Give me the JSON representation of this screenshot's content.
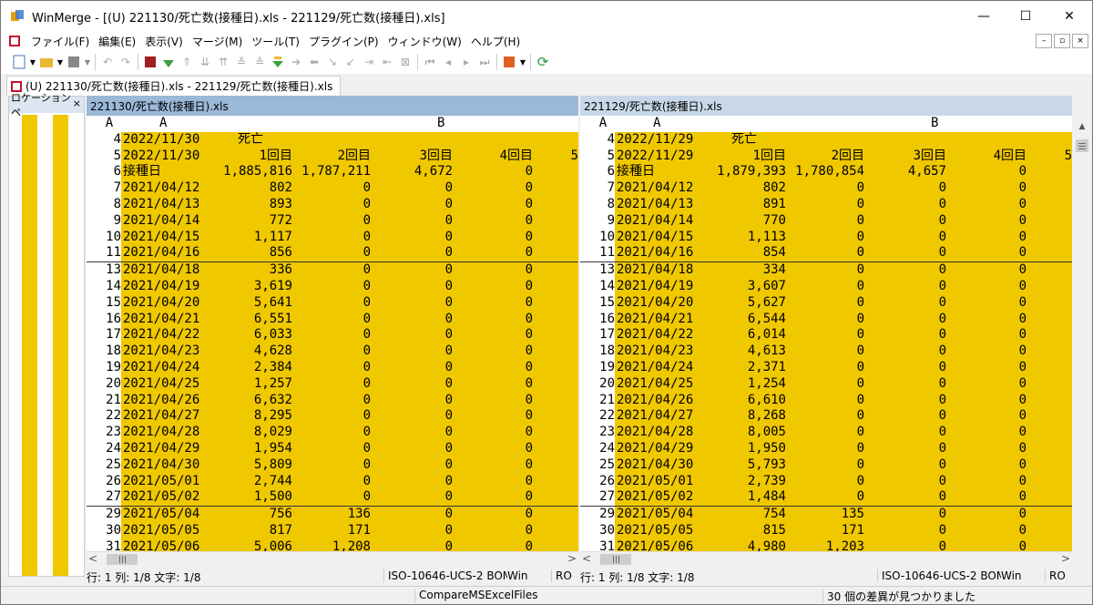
{
  "title": "WinMerge - [(U) 221130/死亡数(接種日).xls - 221129/死亡数(接種日).xls]",
  "window_buttons": {
    "minimize": "—",
    "maximize": "☐",
    "close": "✕"
  },
  "menu": [
    "ファイル(F)",
    "編集(E)",
    "表示(V)",
    "マージ(M)",
    "ツール(T)",
    "プラグイン(P)",
    "ウィンドウ(W)",
    "ヘルプ(H)"
  ],
  "mdi_buttons": {
    "minimize": "–",
    "restore": "▫",
    "close": "×"
  },
  "tab_label": "(U) 221130/死亡数(接種日).xls - 221129/死亡数(接種日).xls",
  "location_pane": {
    "title": "ロケーション ペ",
    "close": "×"
  },
  "colors": {
    "diff": "#f0c800",
    "left_header": "#9ab8d8",
    "right_header": "#c8d8e8"
  },
  "left": {
    "header": "221130/死亡数(接種日).xls",
    "col_header": {
      "rownum": "A",
      "a": "A",
      "b": "B"
    },
    "rows": [
      {
        "n": "4",
        "a": "2022/11/30",
        "c1": "死亡",
        "c2": "",
        "c3": "",
        "c4": "",
        "c5": ""
      },
      {
        "n": "5",
        "a": "2022/11/30",
        "c1": "1回目",
        "c2": "2回目",
        "c3": "3回目",
        "c4": "4回目",
        "c5": "5"
      },
      {
        "n": "6",
        "a": "接種日",
        "c1": "1,885,816",
        "c2": "1,787,211",
        "c3": "4,672",
        "c4": "0",
        "c5": ""
      },
      {
        "n": "7",
        "a": "2021/04/12",
        "c1": "802",
        "c2": "0",
        "c3": "0",
        "c4": "0",
        "c5": ""
      },
      {
        "n": "8",
        "a": "2021/04/13",
        "c1": "893",
        "c2": "0",
        "c3": "0",
        "c4": "0",
        "c5": ""
      },
      {
        "n": "9",
        "a": "2021/04/14",
        "c1": "772",
        "c2": "0",
        "c3": "0",
        "c4": "0",
        "c5": ""
      },
      {
        "n": "10",
        "a": "2021/04/15",
        "c1": "1,117",
        "c2": "0",
        "c3": "0",
        "c4": "0",
        "c5": ""
      },
      {
        "n": "11",
        "a": "2021/04/16",
        "c1": "856",
        "c2": "0",
        "c3": "0",
        "c4": "0",
        "c5": ""
      },
      {
        "n": "13",
        "a": "2021/04/18",
        "c1": "336",
        "c2": "0",
        "c3": "0",
        "c4": "0",
        "c5": ""
      },
      {
        "n": "14",
        "a": "2021/04/19",
        "c1": "3,619",
        "c2": "0",
        "c3": "0",
        "c4": "0",
        "c5": ""
      },
      {
        "n": "15",
        "a": "2021/04/20",
        "c1": "5,641",
        "c2": "0",
        "c3": "0",
        "c4": "0",
        "c5": ""
      },
      {
        "n": "16",
        "a": "2021/04/21",
        "c1": "6,551",
        "c2": "0",
        "c3": "0",
        "c4": "0",
        "c5": ""
      },
      {
        "n": "17",
        "a": "2021/04/22",
        "c1": "6,033",
        "c2": "0",
        "c3": "0",
        "c4": "0",
        "c5": ""
      },
      {
        "n": "18",
        "a": "2021/04/23",
        "c1": "4,628",
        "c2": "0",
        "c3": "0",
        "c4": "0",
        "c5": ""
      },
      {
        "n": "19",
        "a": "2021/04/24",
        "c1": "2,384",
        "c2": "0",
        "c3": "0",
        "c4": "0",
        "c5": ""
      },
      {
        "n": "20",
        "a": "2021/04/25",
        "c1": "1,257",
        "c2": "0",
        "c3": "0",
        "c4": "0",
        "c5": ""
      },
      {
        "n": "21",
        "a": "2021/04/26",
        "c1": "6,632",
        "c2": "0",
        "c3": "0",
        "c4": "0",
        "c5": ""
      },
      {
        "n": "22",
        "a": "2021/04/27",
        "c1": "8,295",
        "c2": "0",
        "c3": "0",
        "c4": "0",
        "c5": ""
      },
      {
        "n": "23",
        "a": "2021/04/28",
        "c1": "8,029",
        "c2": "0",
        "c3": "0",
        "c4": "0",
        "c5": ""
      },
      {
        "n": "24",
        "a": "2021/04/29",
        "c1": "1,954",
        "c2": "0",
        "c3": "0",
        "c4": "0",
        "c5": ""
      },
      {
        "n": "25",
        "a": "2021/04/30",
        "c1": "5,809",
        "c2": "0",
        "c3": "0",
        "c4": "0",
        "c5": ""
      },
      {
        "n": "26",
        "a": "2021/05/01",
        "c1": "2,744",
        "c2": "0",
        "c3": "0",
        "c4": "0",
        "c5": ""
      },
      {
        "n": "27",
        "a": "2021/05/02",
        "c1": "1,500",
        "c2": "0",
        "c3": "0",
        "c4": "0",
        "c5": ""
      },
      {
        "n": "29",
        "a": "2021/05/04",
        "c1": "756",
        "c2": "136",
        "c3": "0",
        "c4": "0",
        "c5": ""
      },
      {
        "n": "30",
        "a": "2021/05/05",
        "c1": "817",
        "c2": "171",
        "c3": "0",
        "c4": "0",
        "c5": ""
      },
      {
        "n": "31",
        "a": "2021/05/06",
        "c1": "5,006",
        "c2": "1,208",
        "c3": "0",
        "c4": "0",
        "c5": ""
      }
    ],
    "status": {
      "pos": "行: 1  列: 1/8  文字: 1/8",
      "enc": "ISO-10646-UCS-2 BOM",
      "eol": "Win",
      "ro": "RO"
    }
  },
  "right": {
    "header": "221129/死亡数(接種日).xls",
    "col_header": {
      "rownum": "A",
      "a": "A",
      "b": "B"
    },
    "rows": [
      {
        "n": "4",
        "a": "2022/11/29",
        "c1": "死亡",
        "c2": "",
        "c3": "",
        "c4": "",
        "c5": ""
      },
      {
        "n": "5",
        "a": "2022/11/29",
        "c1": "1回目",
        "c2": "2回目",
        "c3": "3回目",
        "c4": "4回目",
        "c5": "5"
      },
      {
        "n": "6",
        "a": "接種日",
        "c1": "1,879,393",
        "c2": "1,780,854",
        "c3": "4,657",
        "c4": "0",
        "c5": ""
      },
      {
        "n": "7",
        "a": "2021/04/12",
        "c1": "802",
        "c2": "0",
        "c3": "0",
        "c4": "0",
        "c5": ""
      },
      {
        "n": "8",
        "a": "2021/04/13",
        "c1": "891",
        "c2": "0",
        "c3": "0",
        "c4": "0",
        "c5": ""
      },
      {
        "n": "9",
        "a": "2021/04/14",
        "c1": "770",
        "c2": "0",
        "c3": "0",
        "c4": "0",
        "c5": ""
      },
      {
        "n": "10",
        "a": "2021/04/15",
        "c1": "1,113",
        "c2": "0",
        "c3": "0",
        "c4": "0",
        "c5": ""
      },
      {
        "n": "11",
        "a": "2021/04/16",
        "c1": "854",
        "c2": "0",
        "c3": "0",
        "c4": "0",
        "c5": ""
      },
      {
        "n": "13",
        "a": "2021/04/18",
        "c1": "334",
        "c2": "0",
        "c3": "0",
        "c4": "0",
        "c5": ""
      },
      {
        "n": "14",
        "a": "2021/04/19",
        "c1": "3,607",
        "c2": "0",
        "c3": "0",
        "c4": "0",
        "c5": ""
      },
      {
        "n": "15",
        "a": "2021/04/20",
        "c1": "5,627",
        "c2": "0",
        "c3": "0",
        "c4": "0",
        "c5": ""
      },
      {
        "n": "16",
        "a": "2021/04/21",
        "c1": "6,544",
        "c2": "0",
        "c3": "0",
        "c4": "0",
        "c5": ""
      },
      {
        "n": "17",
        "a": "2021/04/22",
        "c1": "6,014",
        "c2": "0",
        "c3": "0",
        "c4": "0",
        "c5": ""
      },
      {
        "n": "18",
        "a": "2021/04/23",
        "c1": "4,613",
        "c2": "0",
        "c3": "0",
        "c4": "0",
        "c5": ""
      },
      {
        "n": "19",
        "a": "2021/04/24",
        "c1": "2,371",
        "c2": "0",
        "c3": "0",
        "c4": "0",
        "c5": ""
      },
      {
        "n": "20",
        "a": "2021/04/25",
        "c1": "1,254",
        "c2": "0",
        "c3": "0",
        "c4": "0",
        "c5": ""
      },
      {
        "n": "21",
        "a": "2021/04/26",
        "c1": "6,610",
        "c2": "0",
        "c3": "0",
        "c4": "0",
        "c5": ""
      },
      {
        "n": "22",
        "a": "2021/04/27",
        "c1": "8,268",
        "c2": "0",
        "c3": "0",
        "c4": "0",
        "c5": ""
      },
      {
        "n": "23",
        "a": "2021/04/28",
        "c1": "8,005",
        "c2": "0",
        "c3": "0",
        "c4": "0",
        "c5": ""
      },
      {
        "n": "24",
        "a": "2021/04/29",
        "c1": "1,950",
        "c2": "0",
        "c3": "0",
        "c4": "0",
        "c5": ""
      },
      {
        "n": "25",
        "a": "2021/04/30",
        "c1": "5,793",
        "c2": "0",
        "c3": "0",
        "c4": "0",
        "c5": ""
      },
      {
        "n": "26",
        "a": "2021/05/01",
        "c1": "2,739",
        "c2": "0",
        "c3": "0",
        "c4": "0",
        "c5": ""
      },
      {
        "n": "27",
        "a": "2021/05/02",
        "c1": "1,484",
        "c2": "0",
        "c3": "0",
        "c4": "0",
        "c5": ""
      },
      {
        "n": "29",
        "a": "2021/05/04",
        "c1": "754",
        "c2": "135",
        "c3": "0",
        "c4": "0",
        "c5": ""
      },
      {
        "n": "30",
        "a": "2021/05/05",
        "c1": "815",
        "c2": "171",
        "c3": "0",
        "c4": "0",
        "c5": ""
      },
      {
        "n": "31",
        "a": "2021/05/06",
        "c1": "4,980",
        "c2": "1,203",
        "c3": "0",
        "c4": "0",
        "c5": ""
      }
    ],
    "status": {
      "pos": "行: 1  列: 1/8  文字: 1/8",
      "enc": "ISO-10646-UCS-2 BOM",
      "eol": "Win",
      "ro": "RO"
    }
  },
  "scroll": {
    "left_arrow": "<",
    "right_arrow": ">",
    "up_arrow": "▲"
  },
  "bottom_status": {
    "plugin": "CompareMSExcelFiles",
    "diff_count": "30 個の差異が見つかりました"
  }
}
